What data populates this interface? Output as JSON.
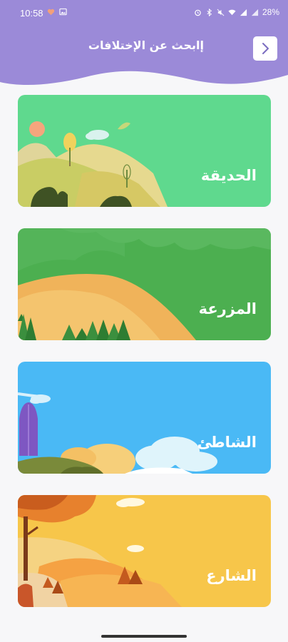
{
  "status_bar": {
    "time": "10:58",
    "battery": "28%"
  },
  "header": {
    "title": "إابحث عن الإختلافات",
    "back_icon": "chevron-right-icon",
    "accent": "#9b8ad8"
  },
  "categories": [
    {
      "label": "الحديقة",
      "color": "#5fd98e"
    },
    {
      "label": "المزرعة",
      "color": "#4caf50"
    },
    {
      "label": "الشاطئ",
      "color": "#4ab9f5"
    },
    {
      "label": "الشارع",
      "color": "#f7c64a"
    }
  ]
}
